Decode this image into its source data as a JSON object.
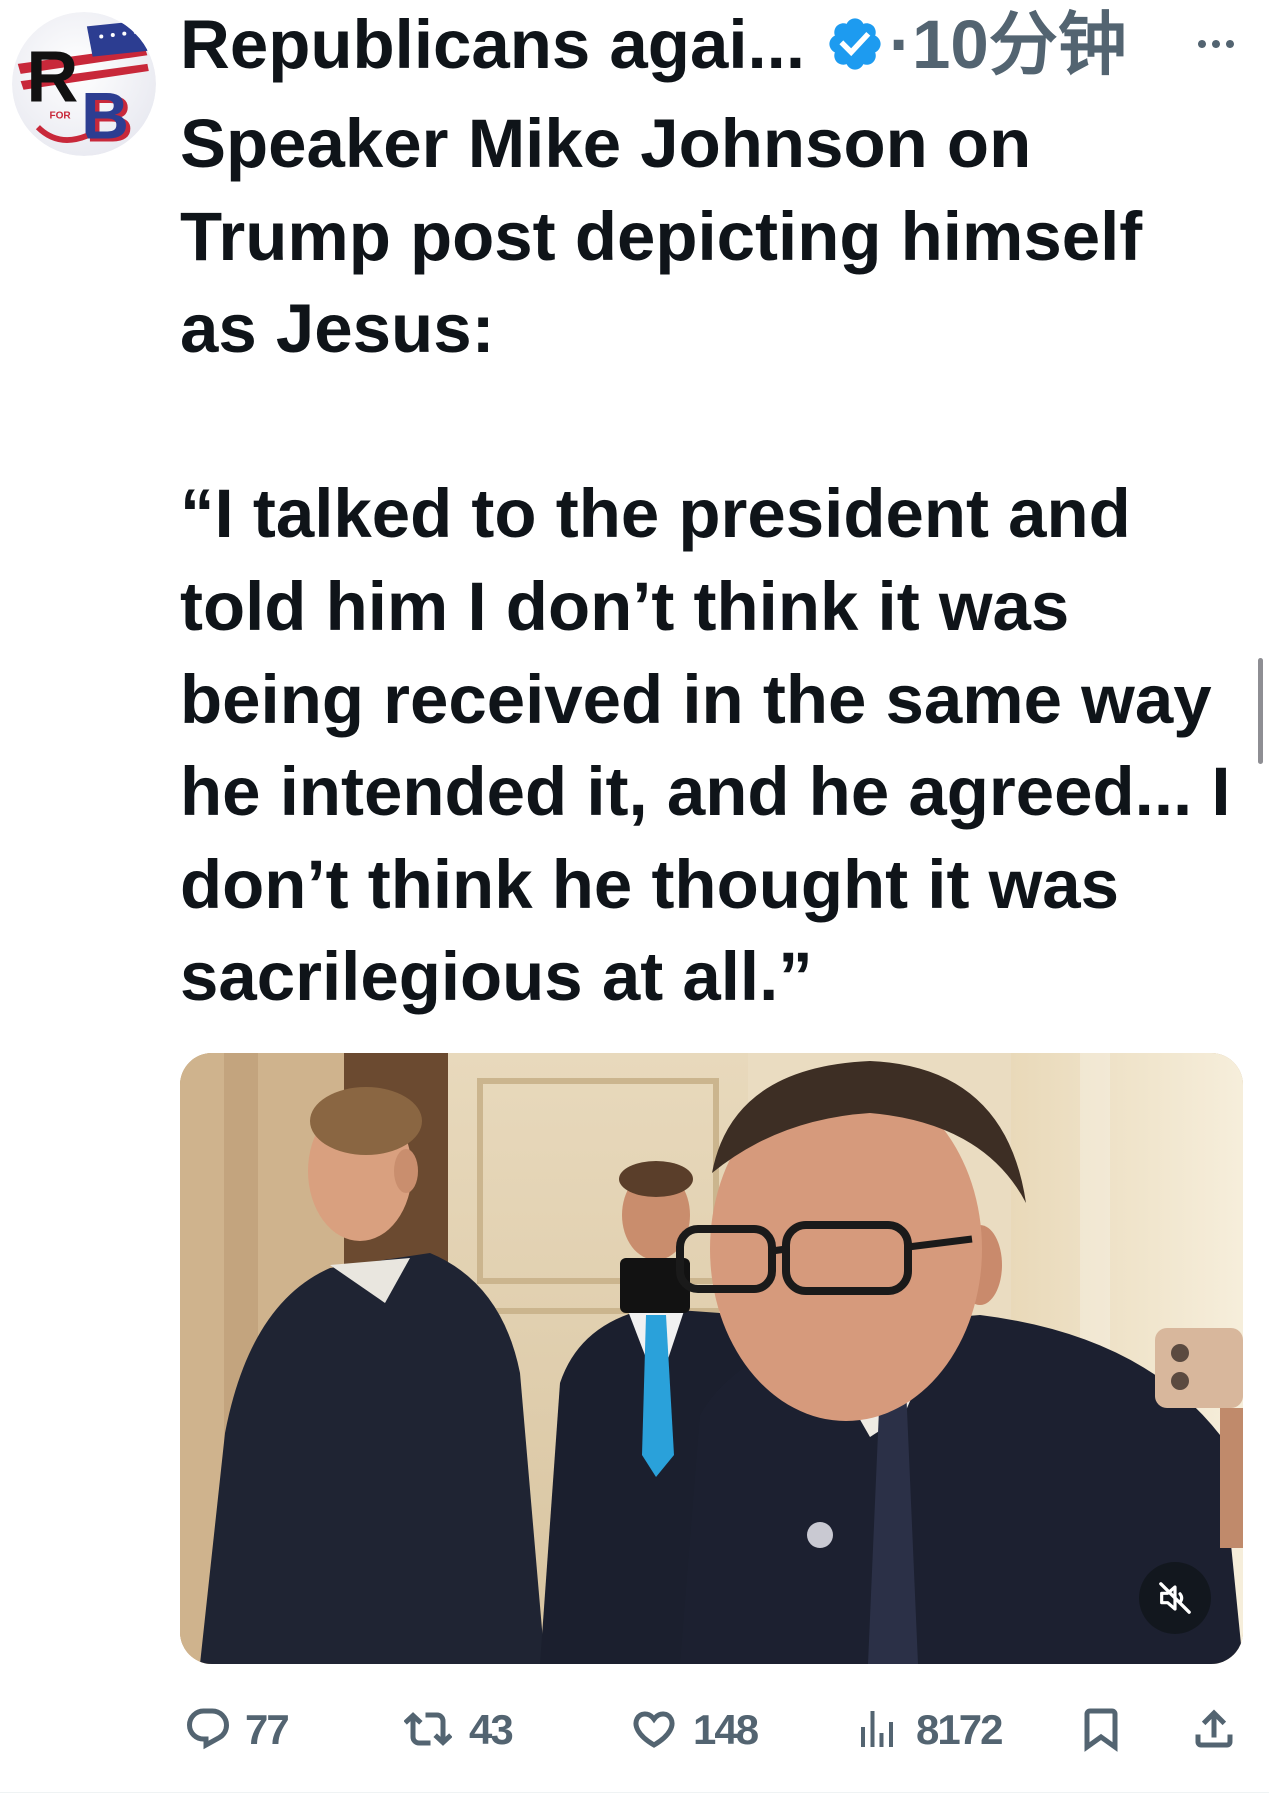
{
  "colors": {
    "text": "#0f1419",
    "secondary": "#536471",
    "verified": "#1d9bf0",
    "background": "#ffffff"
  },
  "post": {
    "author": {
      "display_name": "Republicans agai...",
      "verified": true,
      "verified_icon": "verified-badge-icon",
      "avatar": {
        "icon": "avatar-logo",
        "logo_text": [
          "R",
          "B",
          "FOR"
        ]
      }
    },
    "separator": "·",
    "timestamp": "10分钟",
    "more_icon": "more-horizontal-icon",
    "text_paragraphs": [
      [
        "Speaker Mike Johnson on",
        "Trump post depicting himself",
        "as Jesus:"
      ],
      [
        "“I talked to the president and",
        "told him I don’t think it was",
        "being received in the same way",
        "he intended it, and he agreed... I",
        "don’t think he thought it was",
        "sacrilegious at all.”"
      ]
    ],
    "media": {
      "muted": true,
      "mute_icon": "volume-muted-icon"
    },
    "actions": [
      {
        "icon": "reply-icon",
        "count": "77"
      },
      {
        "icon": "retweet-icon",
        "count": "43"
      },
      {
        "icon": "heart-icon",
        "count": "148"
      },
      {
        "icon": "views-icon",
        "count": "8172"
      },
      {
        "icon": "bookmark-icon"
      },
      {
        "icon": "share-icon"
      }
    ]
  }
}
